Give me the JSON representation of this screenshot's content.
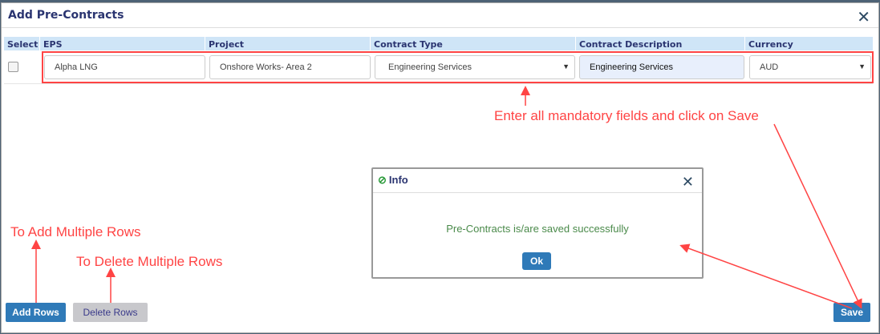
{
  "dialog": {
    "title": "Add Pre-Contracts"
  },
  "table": {
    "headers": [
      "Select",
      "EPS",
      "Project",
      "Contract Type",
      "Contract Description",
      "Currency"
    ],
    "row": {
      "eps": "Alpha LNG",
      "project": "Onshore  Works- Area 2",
      "contract_type": "Engineering Services",
      "contract_description": "Engineering Services",
      "currency": "AUD"
    }
  },
  "buttons": {
    "add_rows": "Add Rows",
    "delete_rows": "Delete Rows",
    "save": "Save"
  },
  "annotations": {
    "mandatory": "Enter all mandatory fields and click on Save",
    "add": "To Add Multiple Rows",
    "delete": "To Delete Multiple Rows"
  },
  "info": {
    "title": "Info",
    "message": "Pre-Contracts is/are saved successfully",
    "ok": "Ok"
  },
  "colors": {
    "accent": "#2f7ab8",
    "annotation": "#ff4444",
    "header_bg": "#cfe5f7"
  }
}
